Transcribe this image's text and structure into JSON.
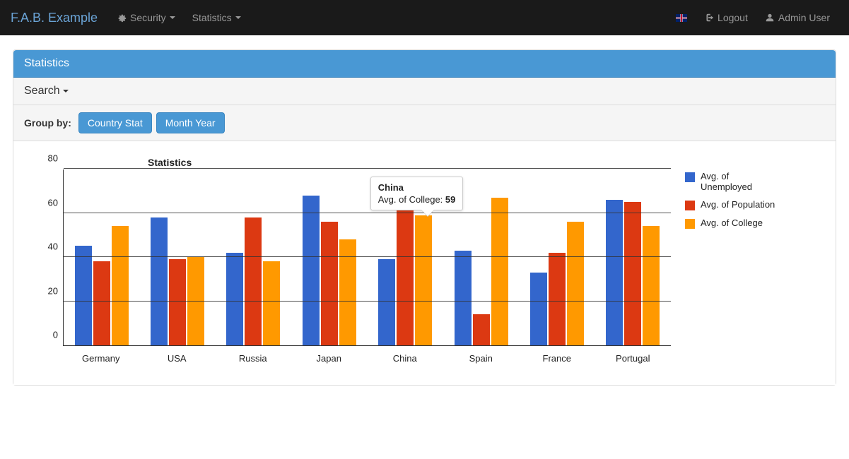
{
  "nav": {
    "brand": "F.A.B. Example",
    "security": "Security",
    "statistics": "Statistics",
    "logout": "Logout",
    "user": "Admin User"
  },
  "panel": {
    "title": "Statistics",
    "search_label": "Search",
    "groupby_label": "Group by:",
    "groupby_buttons": [
      "Country Stat",
      "Month Year"
    ]
  },
  "tooltip": {
    "category": "China",
    "metric_label": "Avg. of College:",
    "value": "59"
  },
  "chart_data": {
    "type": "bar",
    "title": "Statistics",
    "categories": [
      "Germany",
      "USA",
      "Russia",
      "Japan",
      "China",
      "Spain",
      "France",
      "Portugal"
    ],
    "series": [
      {
        "name": "Avg. of Unemployed",
        "color": "#3366cc",
        "values": [
          45,
          58,
          42,
          68,
          39,
          43,
          33,
          66
        ]
      },
      {
        "name": "Avg. of Population",
        "color": "#dc3912",
        "values": [
          38,
          39,
          58,
          56,
          63,
          14,
          42,
          65
        ]
      },
      {
        "name": "Avg. of College",
        "color": "#ff9900",
        "values": [
          54,
          40,
          38,
          48,
          59,
          67,
          56,
          54
        ]
      }
    ],
    "ylim": [
      0,
      80
    ],
    "yticks": [
      0,
      20,
      40,
      60,
      80
    ],
    "xlabel": "",
    "ylabel": ""
  }
}
